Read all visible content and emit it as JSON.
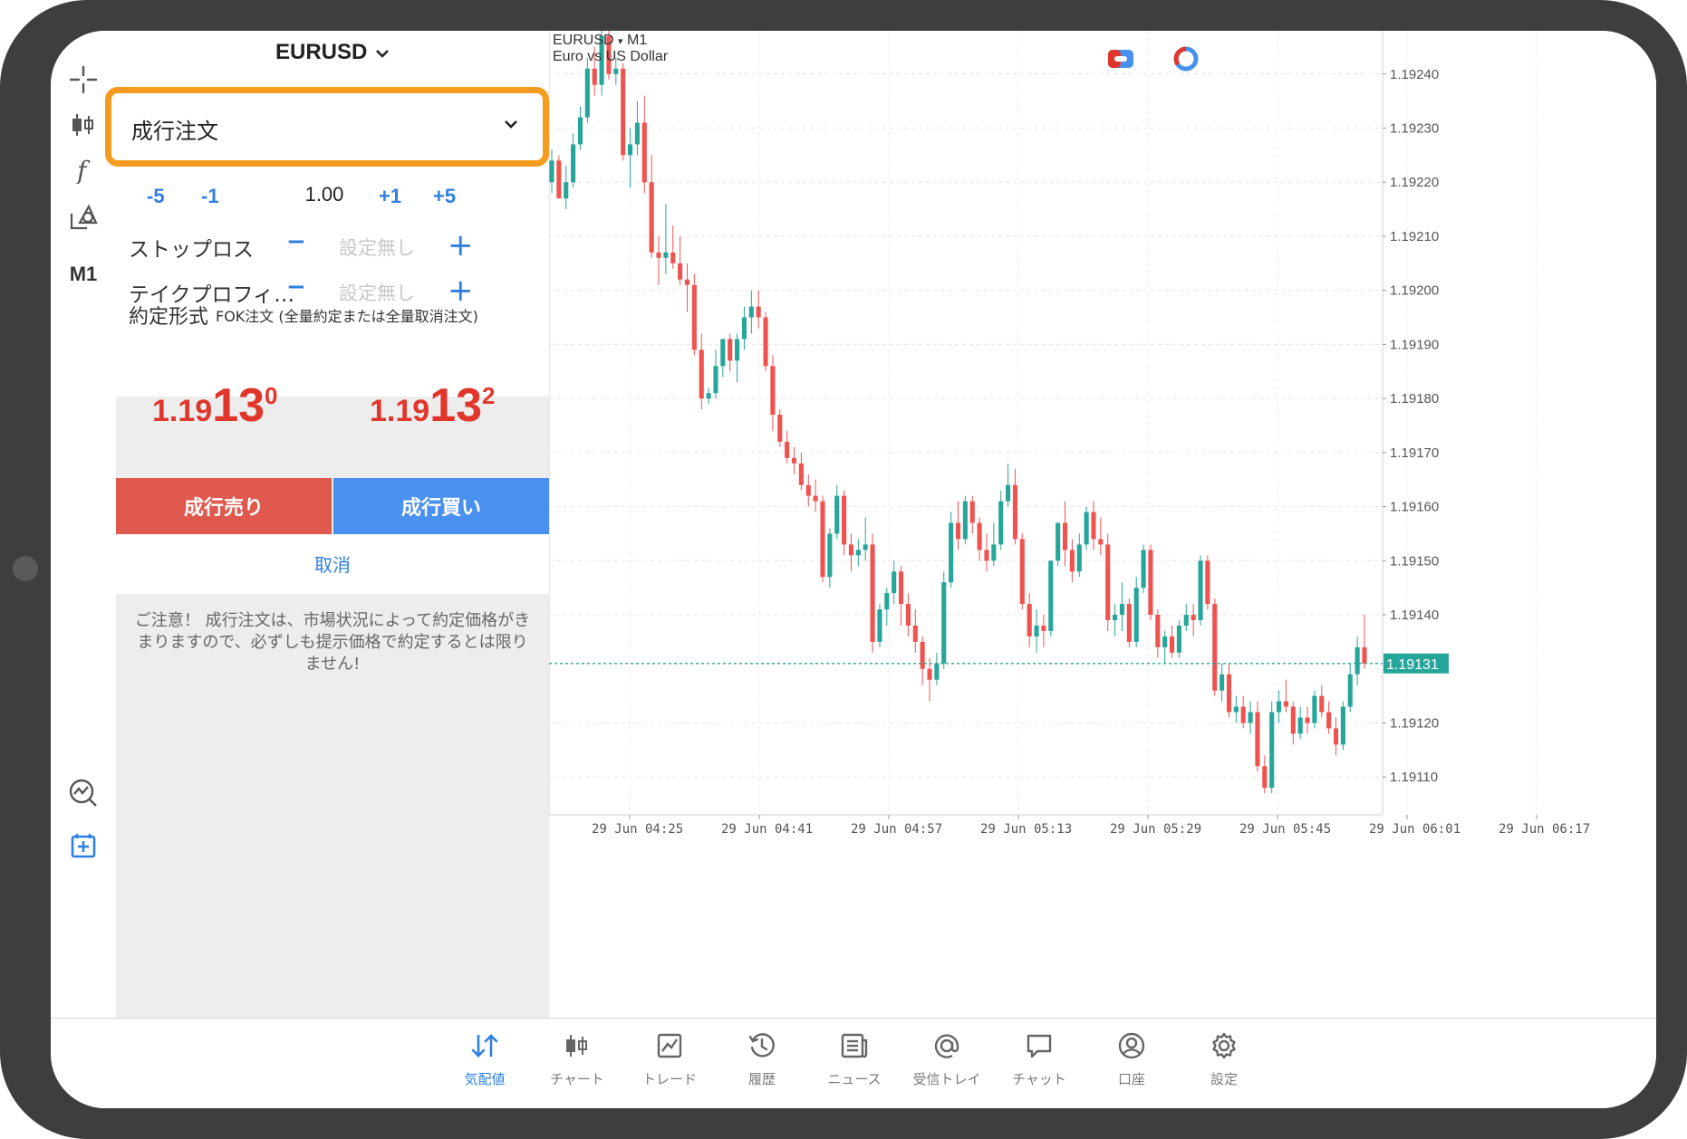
{
  "order_panel": {
    "symbol": "EURUSD",
    "order_type": "成行注文",
    "volume": {
      "minus5": "-5",
      "minus1": "-1",
      "value": "1.00",
      "plus1": "+1",
      "plus5": "+5"
    },
    "stop_loss": {
      "label": "ストップロス",
      "minus": "−",
      "value": "設定無し",
      "plus": "+"
    },
    "take_profit": {
      "label": "テイクプロフィ…",
      "minus": "−",
      "value": "設定無し",
      "plus": "+"
    },
    "fill": {
      "label": "約定形式",
      "value": "FOK注文 (全量約定または全量取消注文)"
    },
    "bid": {
      "prefix": "1.19",
      "big": "13",
      "sup": "0"
    },
    "ask": {
      "prefix": "1.19",
      "big": "13",
      "sup": "2"
    },
    "sell_label": "成行売り",
    "buy_label": "成行買い",
    "cancel_label": "取消",
    "notice": "ご注意！ 成行注文は、市場状況によって約定価格がきまりますので、必ずしも提示価格で約定するとは限りません!"
  },
  "toolbar": {
    "timeframe": "M1"
  },
  "chart": {
    "symbol": "EURUSD",
    "dropdown_marker": "▾",
    "timeframe": "M1",
    "description": "Euro vs US Dollar",
    "current_price_label": "1.19131",
    "colors": {
      "bull": "#26a69a",
      "bear": "#ef5350",
      "current_line": "#26a69a"
    }
  },
  "chart_data": {
    "type": "candlestick",
    "y_ticks": [
      "1.19240",
      "1.19230",
      "1.19220",
      "1.19210",
      "1.19200",
      "1.19190",
      "1.19180",
      "1.19170",
      "1.19160",
      "1.19150",
      "1.19140",
      "1.19120",
      "1.19110"
    ],
    "ylim": [
      1.19103,
      1.19248
    ],
    "x_ticks": [
      "29 Jun 04:25",
      "29 Jun 04:41",
      "29 Jun 04:57",
      "29 Jun 05:13",
      "29 Jun 05:29",
      "29 Jun 05:45",
      "29 Jun 06:01",
      "29 Jun 06:17"
    ],
    "current_price": 1.19131,
    "candles": [
      [
        1.1922,
        1.19226,
        1.19218,
        1.19224
      ],
      [
        1.19224,
        1.19225,
        1.19217,
        1.19217
      ],
      [
        1.19217,
        1.19223,
        1.19215,
        1.1922
      ],
      [
        1.1922,
        1.19229,
        1.19219,
        1.19227
      ],
      [
        1.19227,
        1.19234,
        1.19226,
        1.19232
      ],
      [
        1.19232,
        1.19243,
        1.19231,
        1.19241
      ],
      [
        1.19241,
        1.19245,
        1.19236,
        1.19238
      ],
      [
        1.19238,
        1.19249,
        1.19236,
        1.19247
      ],
      [
        1.19247,
        1.19249,
        1.19239,
        1.1924
      ],
      [
        1.1924,
        1.19243,
        1.19238,
        1.19241
      ],
      [
        1.19241,
        1.19242,
        1.19224,
        1.19225
      ],
      [
        1.19225,
        1.1923,
        1.19219,
        1.19227
      ],
      [
        1.19227,
        1.19235,
        1.19225,
        1.19231
      ],
      [
        1.19231,
        1.19236,
        1.19218,
        1.1922
      ],
      [
        1.1922,
        1.19225,
        1.19206,
        1.19207
      ],
      [
        1.19207,
        1.1921,
        1.19201,
        1.19206
      ],
      [
        1.19206,
        1.19216,
        1.19203,
        1.19207
      ],
      [
        1.19207,
        1.19212,
        1.19204,
        1.19205
      ],
      [
        1.19205,
        1.1921,
        1.19201,
        1.19202
      ],
      [
        1.19202,
        1.19205,
        1.19196,
        1.19201
      ],
      [
        1.19201,
        1.19203,
        1.19188,
        1.19189
      ],
      [
        1.19189,
        1.19192,
        1.19178,
        1.1918
      ],
      [
        1.1918,
        1.19182,
        1.19179,
        1.19181
      ],
      [
        1.19181,
        1.19189,
        1.1918,
        1.19186
      ],
      [
        1.19186,
        1.19191,
        1.19184,
        1.19191
      ],
      [
        1.19191,
        1.19192,
        1.19185,
        1.19187
      ],
      [
        1.19187,
        1.19192,
        1.19183,
        1.19191
      ],
      [
        1.19191,
        1.19197,
        1.19189,
        1.19195
      ],
      [
        1.19195,
        1.192,
        1.19192,
        1.19197
      ],
      [
        1.19197,
        1.192,
        1.19193,
        1.19195
      ],
      [
        1.19195,
        1.19196,
        1.19185,
        1.19186
      ],
      [
        1.19186,
        1.19188,
        1.19174,
        1.19177
      ],
      [
        1.19177,
        1.19178,
        1.19171,
        1.19172
      ],
      [
        1.19172,
        1.19174,
        1.19168,
        1.19169
      ],
      [
        1.19169,
        1.19171,
        1.19166,
        1.19168
      ],
      [
        1.19168,
        1.1917,
        1.19163,
        1.19164
      ],
      [
        1.19164,
        1.19166,
        1.1916,
        1.19162
      ],
      [
        1.19162,
        1.19165,
        1.19159,
        1.19161
      ],
      [
        1.19161,
        1.19162,
        1.19146,
        1.19147
      ],
      [
        1.19147,
        1.19156,
        1.19145,
        1.19155
      ],
      [
        1.19155,
        1.19164,
        1.19154,
        1.19162
      ],
      [
        1.19162,
        1.19163,
        1.19151,
        1.19153
      ],
      [
        1.19153,
        1.19155,
        1.19148,
        1.19151
      ],
      [
        1.19151,
        1.19154,
        1.19149,
        1.19152
      ],
      [
        1.19152,
        1.19158,
        1.1915,
        1.19153
      ],
      [
        1.19153,
        1.19155,
        1.19133,
        1.19135
      ],
      [
        1.19135,
        1.19142,
        1.19134,
        1.19141
      ],
      [
        1.19141,
        1.19145,
        1.19138,
        1.19144
      ],
      [
        1.19144,
        1.1915,
        1.19142,
        1.19148
      ],
      [
        1.19148,
        1.19149,
        1.19138,
        1.19142
      ],
      [
        1.19142,
        1.19144,
        1.19136,
        1.19138
      ],
      [
        1.19138,
        1.19141,
        1.19133,
        1.19135
      ],
      [
        1.19135,
        1.19136,
        1.19127,
        1.1913
      ],
      [
        1.1913,
        1.19132,
        1.19124,
        1.19128
      ],
      [
        1.19128,
        1.19133,
        1.19127,
        1.19131
      ],
      [
        1.19131,
        1.19148,
        1.1913,
        1.19146
      ],
      [
        1.19146,
        1.19159,
        1.19145,
        1.19157
      ],
      [
        1.19157,
        1.19161,
        1.19152,
        1.19154
      ],
      [
        1.19154,
        1.19162,
        1.19153,
        1.19161
      ],
      [
        1.19161,
        1.19162,
        1.19155,
        1.19157
      ],
      [
        1.19157,
        1.19158,
        1.1915,
        1.19152
      ],
      [
        1.19152,
        1.19155,
        1.19148,
        1.1915
      ],
      [
        1.1915,
        1.19157,
        1.19149,
        1.19153
      ],
      [
        1.19153,
        1.19163,
        1.19152,
        1.19161
      ],
      [
        1.19161,
        1.19168,
        1.1916,
        1.19164
      ],
      [
        1.19164,
        1.19167,
        1.19153,
        1.19154
      ],
      [
        1.19154,
        1.19155,
        1.19141,
        1.19142
      ],
      [
        1.19142,
        1.19144,
        1.19134,
        1.19136
      ],
      [
        1.19136,
        1.19141,
        1.19133,
        1.19138
      ],
      [
        1.19138,
        1.1914,
        1.19134,
        1.19137
      ],
      [
        1.19137,
        1.1915,
        1.19136,
        1.1915
      ],
      [
        1.1915,
        1.19157,
        1.19149,
        1.19157
      ],
      [
        1.19157,
        1.19161,
        1.19149,
        1.19152
      ],
      [
        1.19152,
        1.19154,
        1.19146,
        1.19148
      ],
      [
        1.19148,
        1.19155,
        1.19147,
        1.19153
      ],
      [
        1.19153,
        1.1916,
        1.19152,
        1.19159
      ],
      [
        1.19159,
        1.19161,
        1.19152,
        1.19154
      ],
      [
        1.19154,
        1.19158,
        1.19151,
        1.19153
      ],
      [
        1.19153,
        1.19155,
        1.19137,
        1.19139
      ],
      [
        1.19139,
        1.19142,
        1.19136,
        1.1914
      ],
      [
        1.1914,
        1.19146,
        1.19137,
        1.19142
      ],
      [
        1.19142,
        1.19143,
        1.19134,
        1.19135
      ],
      [
        1.19135,
        1.19147,
        1.19134,
        1.19145
      ],
      [
        1.19145,
        1.19153,
        1.19144,
        1.19152
      ],
      [
        1.19152,
        1.19153,
        1.19139,
        1.1914
      ],
      [
        1.1914,
        1.19141,
        1.19132,
        1.19134
      ],
      [
        1.19134,
        1.19137,
        1.19131,
        1.19136
      ],
      [
        1.19136,
        1.19138,
        1.19132,
        1.19133
      ],
      [
        1.19133,
        1.19139,
        1.19132,
        1.19138
      ],
      [
        1.19138,
        1.19142,
        1.19137,
        1.1914
      ],
      [
        1.1914,
        1.19142,
        1.19136,
        1.19139
      ],
      [
        1.19139,
        1.19151,
        1.19138,
        1.1915
      ],
      [
        1.1915,
        1.19151,
        1.19141,
        1.19142
      ],
      [
        1.19142,
        1.19143,
        1.19125,
        1.19126
      ],
      [
        1.19126,
        1.19131,
        1.19124,
        1.19129
      ],
      [
        1.19129,
        1.19131,
        1.19121,
        1.19122
      ],
      [
        1.19122,
        1.19125,
        1.1912,
        1.19123
      ],
      [
        1.19123,
        1.19125,
        1.19119,
        1.1912
      ],
      [
        1.1912,
        1.19124,
        1.19118,
        1.19122
      ],
      [
        1.19122,
        1.19124,
        1.19111,
        1.19112
      ],
      [
        1.19112,
        1.19114,
        1.19107,
        1.19108
      ],
      [
        1.19108,
        1.19124,
        1.19107,
        1.19122
      ],
      [
        1.19122,
        1.19126,
        1.1912,
        1.19124
      ],
      [
        1.19124,
        1.19128,
        1.19122,
        1.19123
      ],
      [
        1.19123,
        1.19124,
        1.19116,
        1.19118
      ],
      [
        1.19118,
        1.19123,
        1.19117,
        1.19121
      ],
      [
        1.19121,
        1.19123,
        1.19118,
        1.1912
      ],
      [
        1.1912,
        1.19126,
        1.19119,
        1.19125
      ],
      [
        1.19125,
        1.19127,
        1.19121,
        1.19122
      ],
      [
        1.19122,
        1.19124,
        1.19118,
        1.19119
      ],
      [
        1.19119,
        1.19121,
        1.19114,
        1.19116
      ],
      [
        1.19116,
        1.19124,
        1.19115,
        1.19123
      ],
      [
        1.19123,
        1.19131,
        1.19122,
        1.19129
      ],
      [
        1.19129,
        1.19136,
        1.19127,
        1.19134
      ],
      [
        1.19134,
        1.1914,
        1.1913,
        1.19131
      ]
    ]
  },
  "bottom_nav": {
    "items": [
      {
        "label": "気配値",
        "icon": "quotes-icon",
        "active": true
      },
      {
        "label": "チャート",
        "icon": "chart-icon",
        "active": false
      },
      {
        "label": "トレード",
        "icon": "trade-icon",
        "active": false
      },
      {
        "label": "履歴",
        "icon": "history-icon",
        "active": false
      },
      {
        "label": "ニュース",
        "icon": "news-icon",
        "active": false
      },
      {
        "label": "受信トレイ",
        "icon": "mailbox-icon",
        "active": false
      },
      {
        "label": "チャット",
        "icon": "chat-icon",
        "active": false
      },
      {
        "label": "口座",
        "icon": "account-icon",
        "active": false
      },
      {
        "label": "設定",
        "icon": "settings-icon",
        "active": false
      }
    ],
    "colors": {
      "active": "#2f7fe0",
      "inactive": "#7a7a7a"
    }
  }
}
